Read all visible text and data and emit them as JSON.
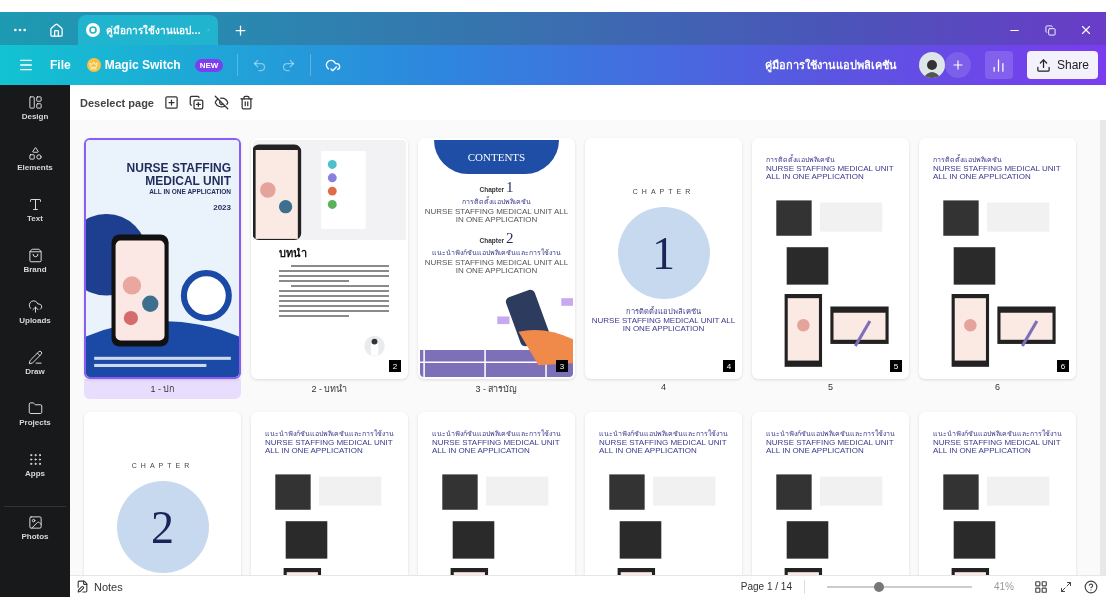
{
  "tab_bar": {
    "tab": {
      "title": "คู่มือการใช้งานแอป…",
      "selected": true
    }
  },
  "toolbar": {
    "file": "File",
    "magic_switch": "Magic Switch",
    "new_badge": "NEW",
    "document_title": "คู่มือการใช้งานแอปพลิเคชัน",
    "share": "Share"
  },
  "sidebar": {
    "items": [
      {
        "label": "Design"
      },
      {
        "label": "Elements"
      },
      {
        "label": "Text"
      },
      {
        "label": "Brand"
      },
      {
        "label": "Uploads"
      },
      {
        "label": "Draw"
      },
      {
        "label": "Projects"
      },
      {
        "label": "Apps"
      },
      {
        "label": "Photos"
      }
    ]
  },
  "page_toolbar": {
    "deselect": "Deselect page"
  },
  "pages": [
    {
      "kind": "cover",
      "label": "1 - ปก",
      "selected": true,
      "title_lines": [
        "NURSE STAFFING",
        "MEDICAL UNIT"
      ],
      "tagline": "ALL IN ONE APPLICATION",
      "year": "2023"
    },
    {
      "kind": "intro",
      "label": "2 - บทนำ",
      "selected": false,
      "heading": "บทนำ",
      "badge": "2"
    },
    {
      "kind": "contents",
      "label": "3 - สารบัญ",
      "selected": false,
      "heading": "CONTENTS",
      "badge": "3",
      "chapters": [
        {
          "word": "Chapter",
          "number": "1",
          "title": "การติดตั้งแอปพลิเคชัน",
          "subtitle": "NURSE STAFFING MEDICAL UNIT ALL IN ONE APPLICATION"
        },
        {
          "word": "Chapter",
          "number": "2",
          "title": "แนะนำฟังก์ชันแอปพลิเคชันและการใช้งาน",
          "subtitle": "NURSE STAFFING MEDICAL UNIT ALL IN ONE APPLICATION"
        }
      ]
    },
    {
      "kind": "chapter",
      "label": "4",
      "selected": false,
      "word": "CHAPTER",
      "number": "1",
      "title": "การติดตั้งแอปพลิเคชัน",
      "subtitle": "NURSE STAFFING MEDICAL UNIT ALL IN ONE APPLICATION",
      "badge": "4"
    },
    {
      "kind": "screens",
      "label": "5",
      "selected": false,
      "title": "การติดตั้งแอปพลิเคชัน",
      "subtitle": "NURSE STAFFING MEDICAL UNIT ALL IN ONE APPLICATION",
      "badge": "5"
    },
    {
      "kind": "screens",
      "label": "6",
      "selected": false,
      "title": "การติดตั้งแอปพลิเคชัน",
      "subtitle": "NURSE STAFFING MEDICAL UNIT ALL IN ONE APPLICATION",
      "badge": "6"
    },
    {
      "kind": "chapter",
      "selected": false,
      "word": "CHAPTER",
      "number": "2"
    },
    {
      "kind": "screens",
      "selected": false,
      "title": "แนะนำฟังก์ชันแอปพลิเคชันและการใช้งาน",
      "subtitle": "NURSE STAFFING MEDICAL UNIT ALL IN ONE APPLICATION"
    },
    {
      "kind": "screens",
      "selected": false,
      "title": "แนะนำฟังก์ชันแอปพลิเคชันและการใช้งาน",
      "subtitle": "NURSE STAFFING MEDICAL UNIT ALL IN ONE APPLICATION"
    },
    {
      "kind": "screens",
      "selected": false,
      "title": "แนะนำฟังก์ชันแอปพลิเคชันและการใช้งาน",
      "subtitle": "NURSE STAFFING MEDICAL UNIT ALL IN ONE APPLICATION"
    },
    {
      "kind": "screens",
      "selected": false,
      "title": "แนะนำฟังก์ชันแอปพลิเคชันและการใช้งาน",
      "subtitle": "NURSE STAFFING MEDICAL UNIT ALL IN ONE APPLICATION"
    },
    {
      "kind": "screens",
      "selected": false,
      "title": "แนะนำฟังก์ชันแอปพลิเคชันและการใช้งาน",
      "subtitle": "NURSE STAFFING MEDICAL UNIT ALL IN ONE APPLICATION"
    }
  ],
  "footer": {
    "notes": "Notes",
    "page_indicator": "Page 1 / 14",
    "zoom": {
      "level": 0.36
    },
    "zoom_reading": "41%"
  }
}
